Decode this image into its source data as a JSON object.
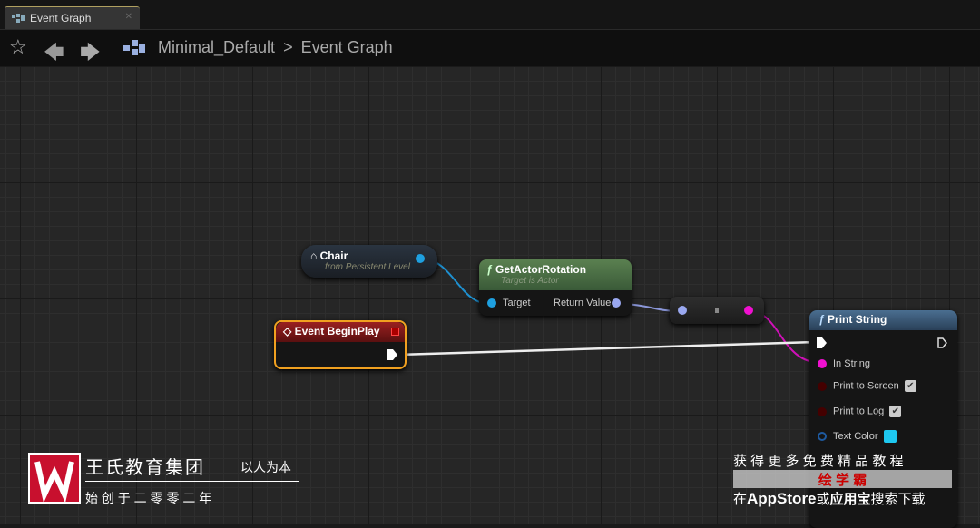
{
  "tab": {
    "label": "Event Graph"
  },
  "breadcrumb": {
    "root": "Minimal_Default",
    "separator": ">",
    "current": "Event Graph"
  },
  "nodes": {
    "chair": {
      "title": "Chair",
      "subtitle": "from Persistent Level"
    },
    "get_rotation": {
      "title": "GetActorRotation",
      "subtitle": "Target is Actor",
      "pin_in": "Target",
      "pin_out": "Return Value"
    },
    "begin_play": {
      "title": "Event BeginPlay"
    },
    "print_string": {
      "title": "Print String",
      "pins": [
        "In String",
        "Print to Screen",
        "Print to Log",
        "Text Color"
      ],
      "print_to_screen": true,
      "print_to_log": true,
      "text_color": "#1ec8f0"
    }
  },
  "watermark": {
    "brand": "王氏教育集团",
    "motto": "以人为本",
    "founded": "始 创 于 二 零 零 二 年",
    "promo_top": "获 得 更 多 免 费 精 品 教 程",
    "promo_app": "绘 学 霸",
    "promo_bottom_pre": "在",
    "promo_bottom_store": "AppStore",
    "promo_bottom_mid": "或",
    "promo_bottom_yyb": "应用宝",
    "promo_bottom_post": "搜索下载"
  },
  "colors": {
    "exec": "#ffffff",
    "object": "#1ea0e0",
    "rotator": "#9aa8f0",
    "string": "#f010d0",
    "event_header": "#8a1a1a",
    "function_header": "#4a6a40",
    "print_header": "#3a5a78",
    "selected": "#f0a020"
  }
}
